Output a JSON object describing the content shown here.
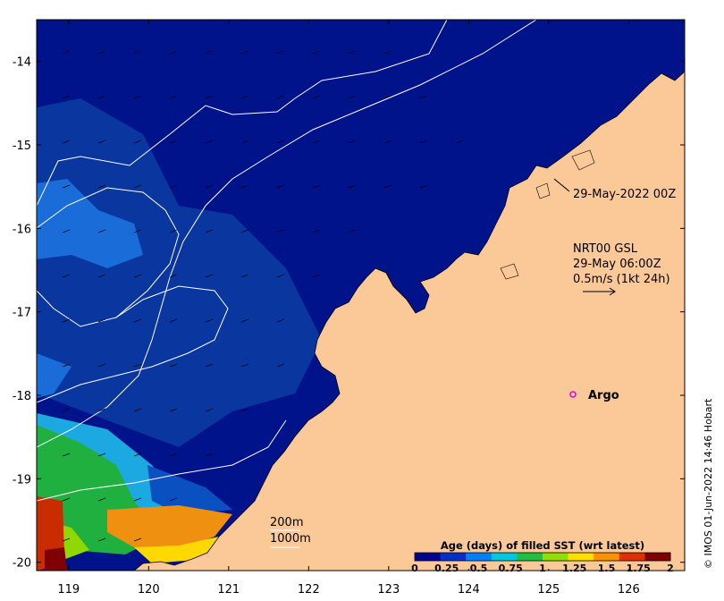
{
  "map": {
    "x_ticks": [
      "119",
      "120",
      "121",
      "122",
      "123",
      "124",
      "125",
      "126"
    ],
    "x_values": [
      119,
      120,
      121,
      122,
      123,
      124,
      125,
      126
    ],
    "y_ticks": [
      "-14",
      "-15",
      "-16",
      "-17",
      "-18",
      "-19",
      "-20"
    ],
    "y_values": [
      -14,
      -15,
      -16,
      -17,
      -18,
      -19,
      -20
    ],
    "lon_range": [
      118.6,
      126.7
    ],
    "lat_range": [
      -20.1,
      -13.5
    ],
    "colors": {
      "land": "#fbc898",
      "ocean_deep": "#00138a",
      "ocean_mid": "#0a3aa8",
      "ocean_light": "#1a7de0",
      "contour": "#ffffff",
      "argo_marker": "#e000e0"
    }
  },
  "annotations": {
    "image_time": "29-May-2022 00Z",
    "current_source": "NRT00 GSL",
    "current_time": "29-May 06:00Z",
    "current_scale": "0.5m/s (1kt 24h)",
    "argo_label": "Argo",
    "depth_200": "200m",
    "depth_1000": "1000m"
  },
  "colorbar": {
    "title": "Age (days) of filled SST (wrt latest)",
    "tick_labels": [
      "0",
      "0.25",
      "0.5",
      "0.75",
      "1",
      "1.25",
      "1.5",
      "1.75",
      "2"
    ],
    "range": [
      0,
      2
    ],
    "colors": [
      "#00008f",
      "#0030c8",
      "#0080ff",
      "#00c8e0",
      "#20c040",
      "#90e000",
      "#ffe000",
      "#ff9000",
      "#e03000",
      "#800000"
    ]
  },
  "credit": "© IMOS 01-Jun-2022 14:46 Hobart"
}
